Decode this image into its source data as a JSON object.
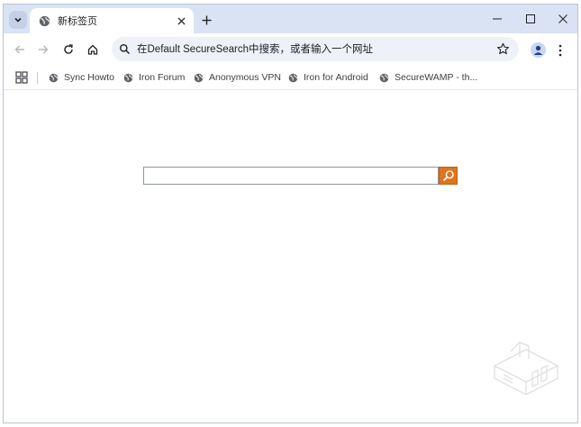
{
  "tab": {
    "title": "新标签页"
  },
  "omnibox": {
    "placeholder": "在Default SecureSearch中搜索，或者输入一个网址"
  },
  "bookmarks": [
    {
      "label": "Sync Howto"
    },
    {
      "label": "Iron Forum"
    },
    {
      "label": "Anonymous VPN"
    },
    {
      "label": "Iron for Android"
    },
    {
      "label": "SecureWAMP - th..."
    }
  ],
  "search": {
    "value": ""
  },
  "colors": {
    "titlebar": "#dae3f4",
    "omnibox": "#eef1f8",
    "search_button": "#e0731c"
  }
}
